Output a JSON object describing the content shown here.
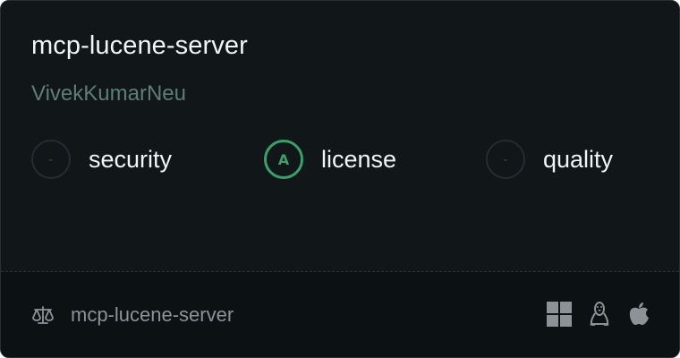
{
  "package": {
    "name": "mcp-lucene-server",
    "owner": "VivekKumarNeu"
  },
  "scores": [
    {
      "key": "security",
      "label": "security",
      "grade": "-"
    },
    {
      "key": "license",
      "label": "license",
      "grade": "A"
    },
    {
      "key": "quality",
      "label": "quality",
      "grade": "-"
    }
  ],
  "footer": {
    "license_icon": "scale-icon",
    "label": "mcp-lucene-server",
    "platforms": [
      "windows-icon",
      "linux-icon",
      "apple-icon"
    ]
  },
  "colors": {
    "card_background": "#111619",
    "footer_background": "#0c1113",
    "owner_text": "#5e7d74",
    "grade_a": "#3aa06a",
    "muted_icon": "#8b9397"
  }
}
